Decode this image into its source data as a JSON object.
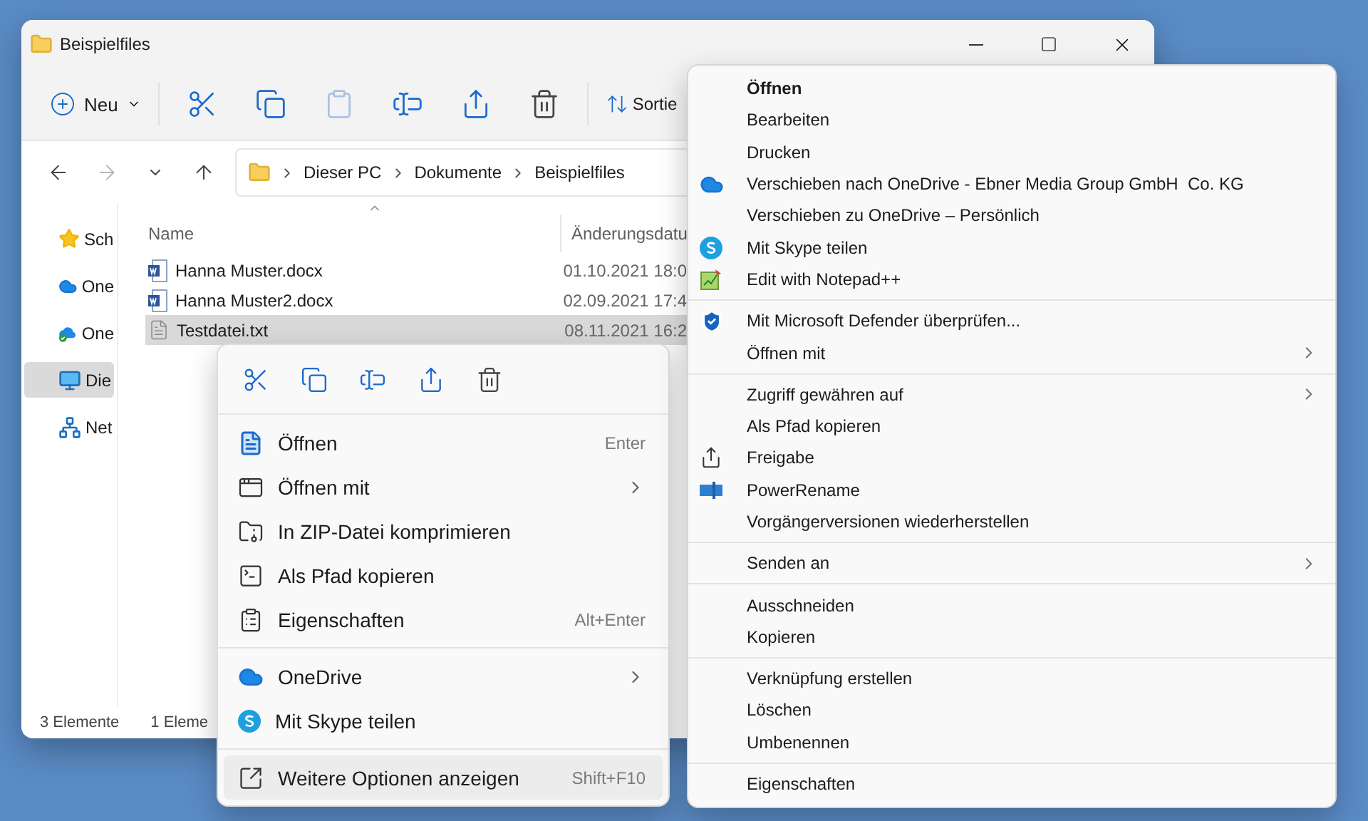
{
  "window": {
    "title": "Beispielfiles"
  },
  "toolbar": {
    "new_label": "Neu",
    "sort_label": "Sortie",
    "buttons": [
      {
        "kind": "cut",
        "disabled": false
      },
      {
        "kind": "copy",
        "disabled": false
      },
      {
        "kind": "paste",
        "disabled": true
      },
      {
        "kind": "rename",
        "disabled": false
      },
      {
        "kind": "share",
        "disabled": false
      },
      {
        "kind": "delete",
        "disabled": false
      }
    ]
  },
  "nav_buttons": [
    {
      "kind": "back",
      "disabled": false
    },
    {
      "kind": "forward",
      "disabled": true
    },
    {
      "kind": "recent",
      "disabled": false
    },
    {
      "kind": "up",
      "disabled": false
    }
  ],
  "address_bar": {
    "path": [
      "Dieser PC",
      "Dokumente",
      "Beispielfiles"
    ]
  },
  "sidebar": {
    "items": [
      {
        "label": "Sch",
        "kind": "star",
        "selected": false
      },
      {
        "label": "One",
        "kind": "cloud",
        "selected": false
      },
      {
        "label": "One",
        "kind": "cloud-synced",
        "selected": false
      },
      {
        "label": "Die",
        "kind": "pc",
        "selected": true
      },
      {
        "label": "Net",
        "kind": "network",
        "selected": false
      }
    ]
  },
  "file_list": {
    "columns": [
      "Name",
      "Änderungsdatu"
    ],
    "rows": [
      {
        "name": "Hanna Muster.docx",
        "date": "01.10.2021 18:0",
        "kind": "word",
        "selected": false
      },
      {
        "name": "Hanna Muster2.docx",
        "date": "02.09.2021 17:4",
        "kind": "word",
        "selected": false
      },
      {
        "name": "Testdatei.txt",
        "date": "08.11.2021 16:2",
        "kind": "text",
        "selected": true
      }
    ]
  },
  "status_bar": [
    "3 Elemente",
    "1 Eleme"
  ],
  "context_menu": {
    "groups": [
      [
        {
          "label": "Öffnen",
          "shortcut": "Enter",
          "kind": "open",
          "submenu": false,
          "selected": false
        },
        {
          "label": "Öffnen mit",
          "kind": "openwith",
          "submenu": true,
          "selected": false
        },
        {
          "label": "In ZIP-Datei komprimieren",
          "kind": "zip",
          "submenu": false,
          "selected": false
        },
        {
          "label": "Als Pfad kopieren",
          "kind": "path",
          "submenu": false,
          "selected": false
        },
        {
          "label": "Eigenschaften",
          "shortcut": "Alt+Enter",
          "kind": "properties",
          "submenu": false,
          "selected": false
        }
      ],
      [
        {
          "label": "OneDrive",
          "kind": "cloud",
          "submenu": true,
          "selected": false
        },
        {
          "label": "Mit Skype teilen",
          "kind": "skype",
          "submenu": false,
          "selected": false
        }
      ],
      [
        {
          "label": "Weitere Optionen anzeigen",
          "shortcut": "Shift+F10",
          "kind": "more",
          "submenu": false,
          "selected": true
        }
      ]
    ]
  },
  "classic_menu": {
    "groups": [
      [
        {
          "label": "Öffnen",
          "kind": "plain",
          "default": true,
          "submenu": false
        },
        {
          "label": "Bearbeiten",
          "kind": "plain",
          "default": false,
          "submenu": false
        },
        {
          "label": "Drucken",
          "kind": "plain",
          "default": false,
          "submenu": false
        },
        {
          "label": "Verschieben nach OneDrive - Ebner Media Group GmbH  Co. KG",
          "kind": "cloud",
          "default": false,
          "submenu": false
        },
        {
          "label": "Verschieben zu OneDrive – Persönlich",
          "kind": "plain",
          "default": false,
          "submenu": false
        },
        {
          "label": "Mit Skype teilen",
          "kind": "skype",
          "default": false,
          "submenu": false
        },
        {
          "label": "Edit with Notepad++",
          "kind": "notepad",
          "default": false,
          "submenu": false
        }
      ],
      [
        {
          "label": "Mit Microsoft Defender überprüfen...",
          "kind": "shield",
          "default": false,
          "submenu": false
        },
        {
          "label": "Öffnen mit",
          "kind": "plain",
          "default": false,
          "submenu": true
        }
      ],
      [
        {
          "label": "Zugriff gewähren auf",
          "kind": "plain",
          "default": false,
          "submenu": true
        },
        {
          "label": "Als Pfad kopieren",
          "kind": "plain",
          "default": false,
          "submenu": false
        },
        {
          "label": "Freigabe",
          "kind": "share",
          "default": false,
          "submenu": false
        },
        {
          "label": "PowerRename",
          "kind": "rename",
          "default": false,
          "submenu": false
        },
        {
          "label": "Vorgängerversionen wiederherstellen",
          "kind": "plain",
          "default": false,
          "submenu": false
        }
      ],
      [
        {
          "label": "Senden an",
          "kind": "plain",
          "default": false,
          "submenu": true
        }
      ],
      [
        {
          "label": "Ausschneiden",
          "kind": "plain",
          "default": false,
          "submenu": false
        },
        {
          "label": "Kopieren",
          "kind": "plain",
          "default": false,
          "submenu": false
        }
      ],
      [
        {
          "label": "Verknüpfung erstellen",
          "kind": "plain",
          "default": false,
          "submenu": false
        },
        {
          "label": "Löschen",
          "kind": "plain",
          "default": false,
          "submenu": false
        },
        {
          "label": "Umbenennen",
          "kind": "plain",
          "default": false,
          "submenu": false
        }
      ],
      [
        {
          "label": "Eigenschaften",
          "kind": "plain",
          "default": false,
          "submenu": false
        }
      ]
    ]
  }
}
